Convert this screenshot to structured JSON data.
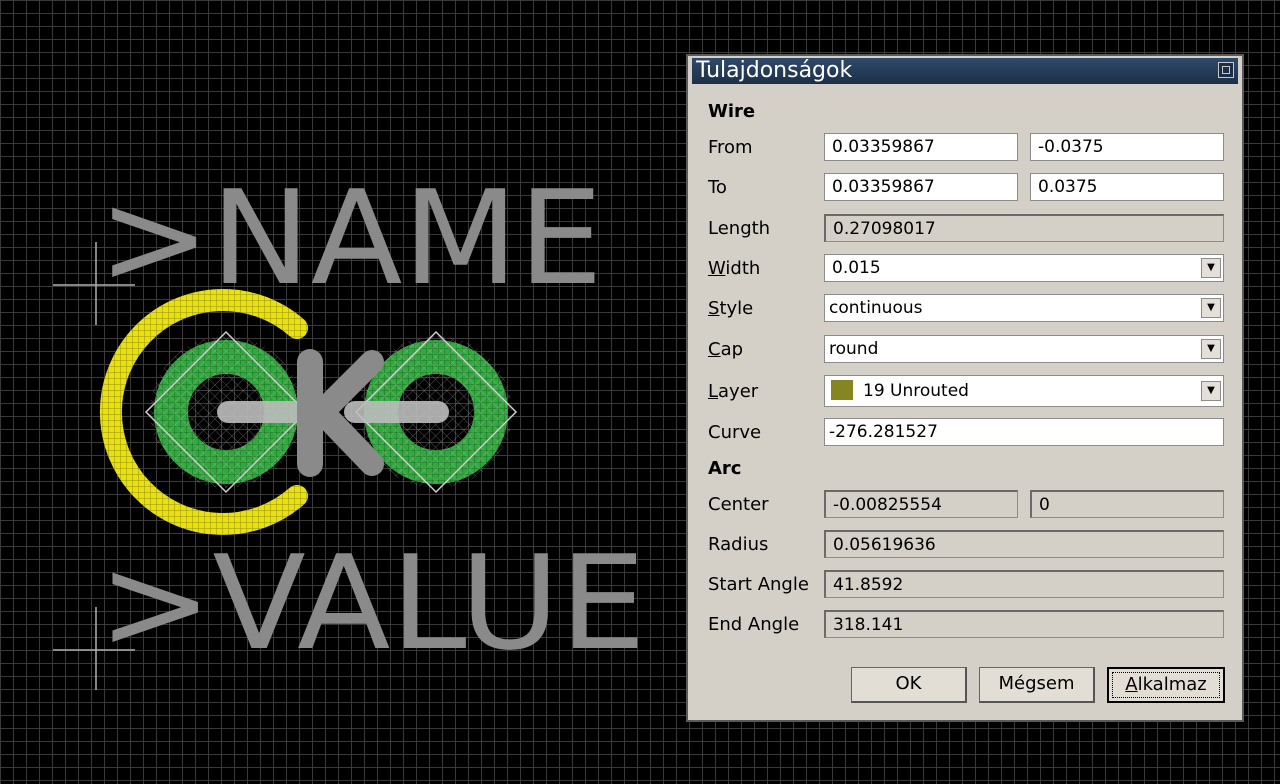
{
  "canvas": {
    "name_text": ">NAME",
    "value_text": ">VALUE",
    "colors": {
      "background": "#000000",
      "grid": "#3a3a3a",
      "silk": "#8a8a8a",
      "pad": "#2faa3c",
      "unrouted": "#e8e010"
    }
  },
  "dialog": {
    "title": "Tulajdonságok",
    "wire_section": "Wire",
    "from_label": "From",
    "from_x": "0.03359867",
    "from_y": "-0.0375",
    "to_label": "To",
    "to_x": "0.03359867",
    "to_y": "0.0375",
    "length_label": "Length",
    "length_value": "0.27098017",
    "width_label_pre": "",
    "width_label_ul": "W",
    "width_label_post": "idth",
    "width_value": "0.015",
    "style_label_ul": "S",
    "style_label_post": "tyle",
    "style_value": "continuous",
    "cap_label_ul": "C",
    "cap_label_post": "ap",
    "cap_value": "round",
    "layer_label_ul": "L",
    "layer_label_post": "ayer",
    "layer_value": "19 Unrouted",
    "layer_color": "#858623",
    "curve_label": "Curve",
    "curve_value": "-276.281527",
    "arc_section": "Arc",
    "center_label": "Center",
    "center_x": "-0.00825554",
    "center_y": "0",
    "radius_label": "Radius",
    "radius_value": "0.05619636",
    "start_angle_label": "Start Angle",
    "start_angle_value": "41.8592",
    "end_angle_label": "End Angle",
    "end_angle_value": "318.141",
    "ok_label": "OK",
    "cancel_label": "Mégsem",
    "apply_label_ul": "A",
    "apply_label_post": "lkalmaz"
  }
}
